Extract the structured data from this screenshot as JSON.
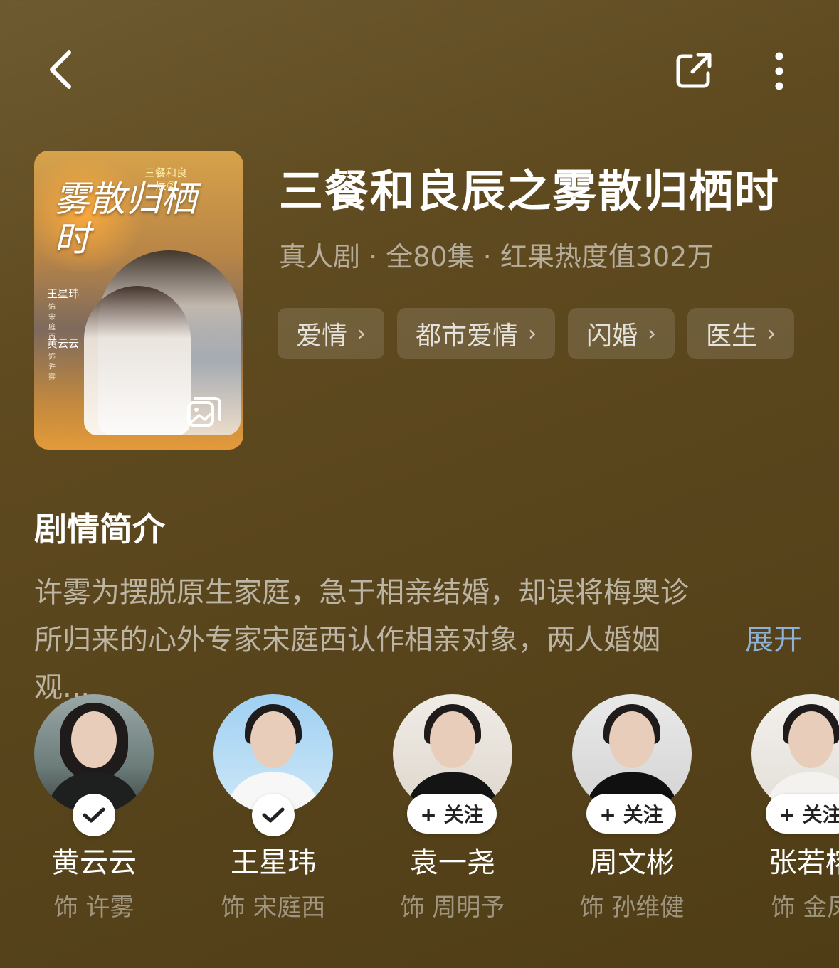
{
  "header": {
    "back_icon": "chevron-left-icon",
    "share_icon": "share-icon",
    "more_icon": "more-vertical-icon"
  },
  "poster": {
    "title_art": "雾散归栖时",
    "series_art": "三餐和良辰②",
    "cast1": "王星玮",
    "cast1_role": "饰 宋庭西",
    "cast2": "黄云云",
    "cast2_role": "饰 许雾",
    "gallery_icon": "gallery-icon"
  },
  "show": {
    "title": "三餐和良辰之雾散归栖时",
    "meta": "真人剧 · 全80集 · 红果热度值302万",
    "tags": [
      "爱情",
      "都市爱情",
      "闪婚",
      "医生"
    ]
  },
  "synopsis": {
    "heading": "剧情简介",
    "text": "许雾为摆脱原生家庭，急于相亲结婚，却误将梅奥诊所归来的心外专家宋庭西认作相亲对象，两人婚姻观...",
    "expand": "展开"
  },
  "cast": [
    {
      "name": "黄云云",
      "role": "饰 许雾",
      "followed": true,
      "badge": "check-icon"
    },
    {
      "name": "王星玮",
      "role": "饰 宋庭西",
      "followed": true,
      "badge": "check-icon"
    },
    {
      "name": "袁一尧",
      "role": "饰 周明予",
      "followed": false,
      "follow_label": "+ 关注"
    },
    {
      "name": "周文彬",
      "role": "饰 孙维健",
      "followed": false,
      "follow_label": "+ 关注"
    },
    {
      "name": "张若榕",
      "role": "饰 金凤",
      "followed": false,
      "follow_label": "+ 关注"
    }
  ],
  "colors": {
    "background": "#5f4a20",
    "link": "#8fb2d8"
  }
}
